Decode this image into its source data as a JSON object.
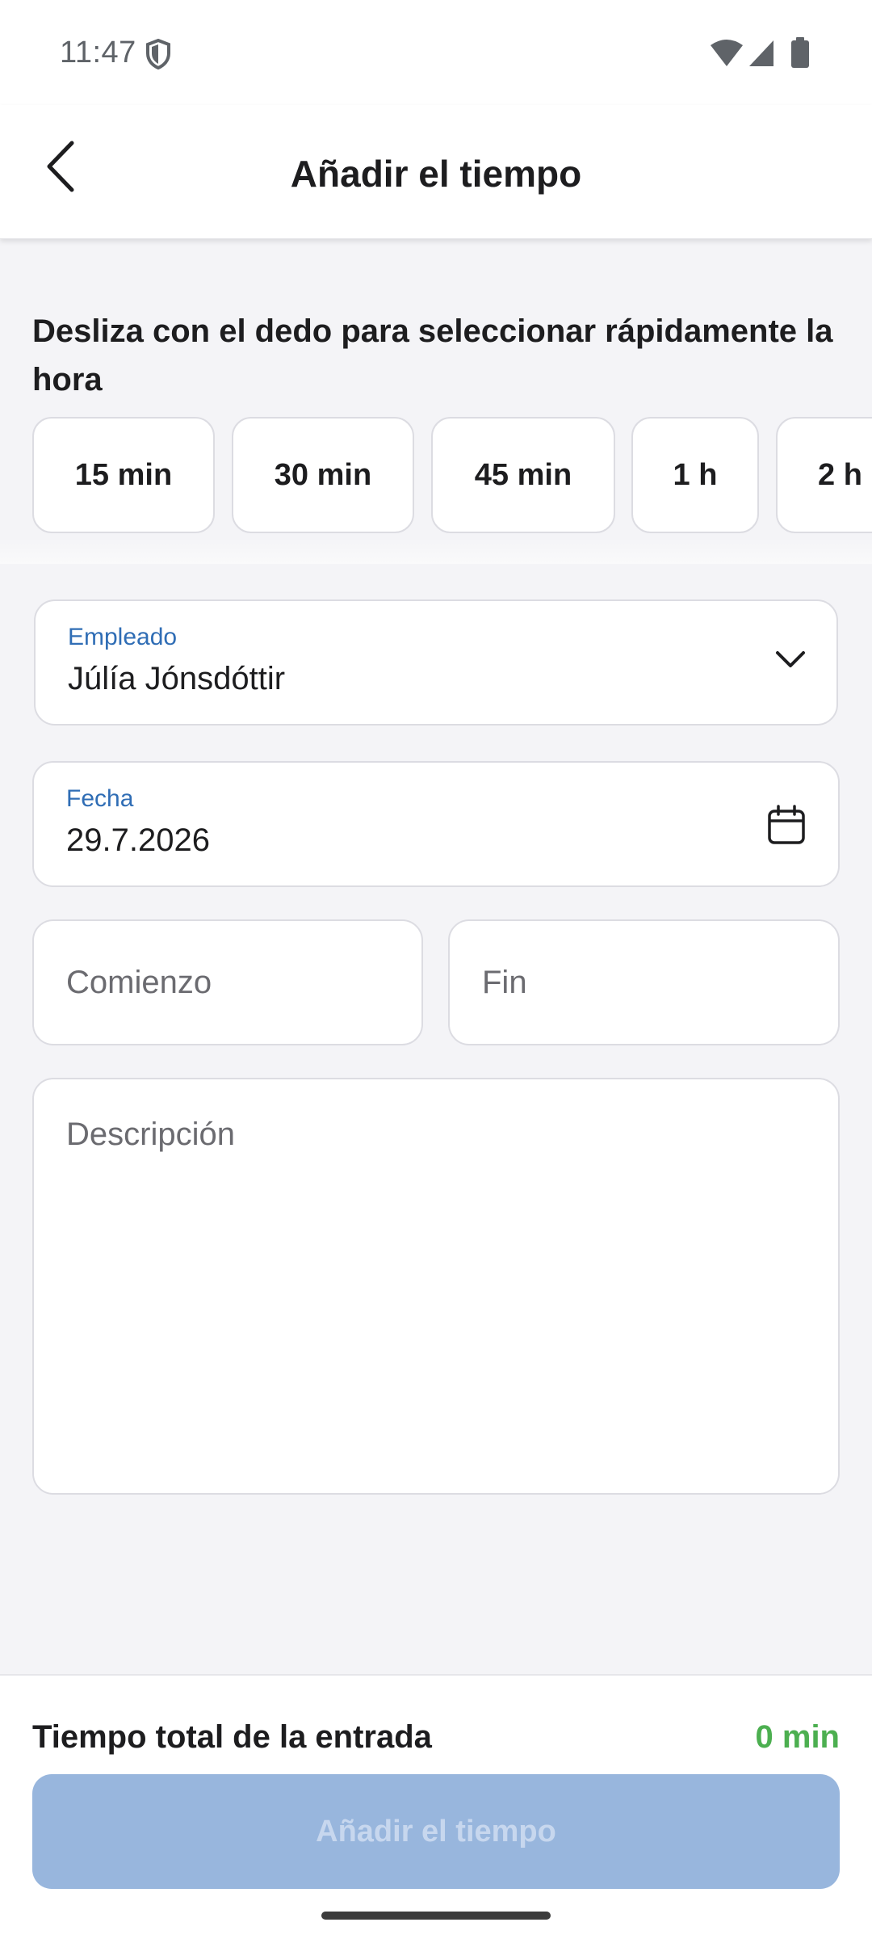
{
  "status_bar": {
    "time": "11:47",
    "icons": [
      "shield-icon",
      "wifi-icon",
      "signal-icon",
      "battery-icon"
    ]
  },
  "app_bar": {
    "title": "Añadir el tiempo",
    "back_icon": "chevron-left-icon"
  },
  "quick_select": {
    "hint": "Desliza con el dedo para seleccionar rápidamente la hora",
    "chips": [
      "15 min",
      "30 min",
      "45 min",
      "1 h",
      "2 h"
    ]
  },
  "form": {
    "employee": {
      "label": "Empleado",
      "value": "Júlía Jónsdóttir",
      "icon": "chevron-down-icon"
    },
    "date": {
      "label": "Fecha",
      "value": "29.7.2026",
      "icon": "calendar-icon"
    },
    "start": {
      "placeholder": "Comienzo"
    },
    "end": {
      "placeholder": "Fin"
    },
    "description": {
      "placeholder": "Descripción"
    }
  },
  "footer": {
    "total_label": "Tiempo total de la entrada",
    "total_value": "0 min",
    "submit_label": "Añadir el tiempo"
  },
  "colors": {
    "accent": "#2f6db5",
    "total": "#4caf50",
    "button_disabled": "#98b6dd",
    "background": "#f4f4f7"
  }
}
